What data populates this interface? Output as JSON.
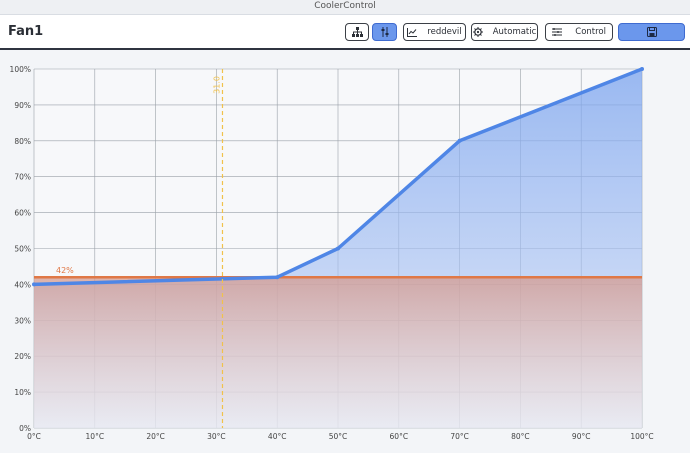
{
  "window": {
    "title": "CoolerControl"
  },
  "header": {
    "title": "Fan1",
    "device_label": "reddevil",
    "mode_label": "Automatic",
    "function_label": "Control"
  },
  "colors": {
    "profile_line": "#4f86e6",
    "duty_line": "#e07846",
    "temp_marker": "#f1c24b",
    "accent_button": "#6b97ec"
  },
  "icons": {
    "tree": "sitemap-icon",
    "sliders": "sliders-icon",
    "graph": "chart-line-icon",
    "gear": "gear-icon",
    "list": "list-icon",
    "save": "save-icon"
  },
  "chart_data": {
    "type": "line",
    "x_axis": {
      "min": 0,
      "max": 100,
      "ticks": [
        "0°C",
        "10°C",
        "20°C",
        "30°C",
        "40°C",
        "50°C",
        "60°C",
        "70°C",
        "80°C",
        "90°C",
        "100°C"
      ]
    },
    "y_axis": {
      "min": 0,
      "max": 100,
      "ticks": [
        "0%",
        "10%",
        "20%",
        "30%",
        "40%",
        "50%",
        "60%",
        "70%",
        "80%",
        "90%",
        "100%"
      ]
    },
    "grid": true,
    "series": [
      {
        "x": [
          0,
          40,
          50,
          70,
          100
        ],
        "y": [
          40,
          42,
          50,
          80,
          100
        ]
      }
    ],
    "duty_line": {
      "value": 42,
      "label": "42%"
    },
    "temp_marker": {
      "value": 31,
      "label": "31.0"
    }
  }
}
